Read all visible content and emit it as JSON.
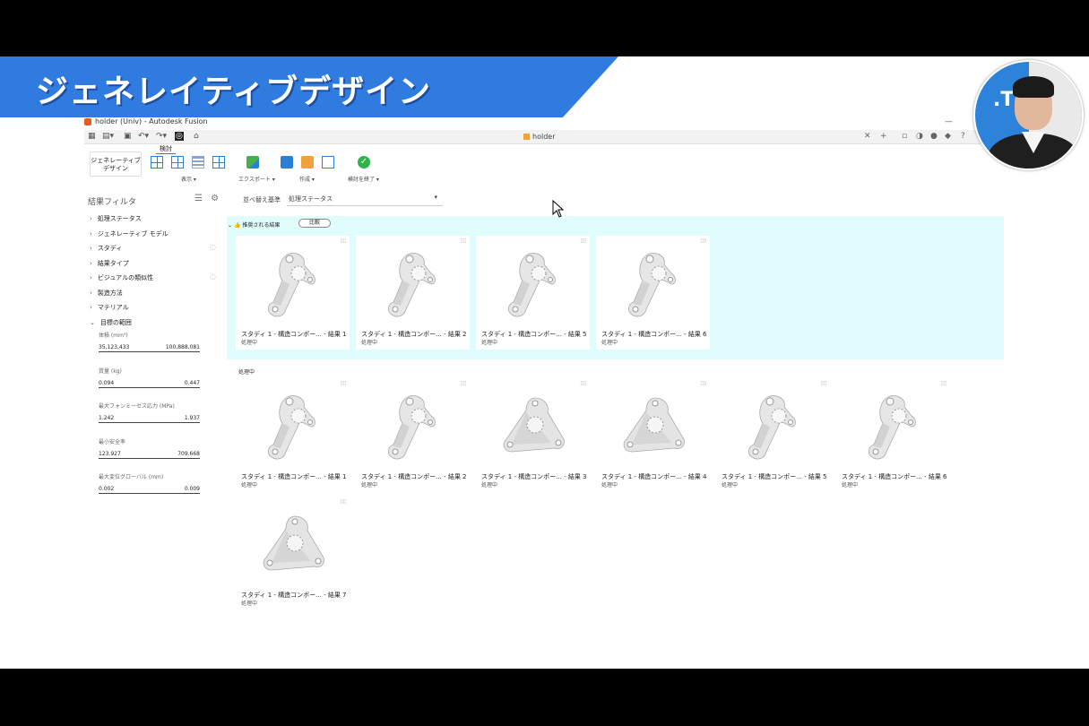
{
  "banner": {
    "title": "ジェネレイティブデザイン"
  },
  "window": {
    "title": "holder (Univ) - Autodesk Fusion",
    "doc_tab": "holder"
  },
  "ribbon": {
    "workspace": [
      "ジェネレーティブ",
      "デザイン"
    ],
    "tab": "検討",
    "groups": {
      "view": "表示 ▾",
      "export": "エクスポート ▾",
      "create": "作成 ▾",
      "finish": "検討を終了 ▾"
    }
  },
  "sidebar": {
    "title": "結果フィルタ",
    "items": [
      "処理ステータス",
      "ジェネレーティブ モデル",
      "スタディ",
      "結果タイプ",
      "ビジュアルの類似性",
      "製造方法",
      "マテリアル",
      "目標の範囲"
    ],
    "ranges": [
      {
        "label": "体積 (mm³)",
        "min": "35,123,433",
        "max": "100,888,081"
      },
      {
        "label": "質量 (kg)",
        "min": "0.094",
        "max": "0.447"
      },
      {
        "label": "最大フォンミーゼス応力 (MPa)",
        "min": "1.242",
        "max": "1.937"
      },
      {
        "label": "最小安全率",
        "min": "123.927",
        "max": "709.668"
      },
      {
        "label": "最大変位グローバル (mm)",
        "min": "0.002",
        "max": "0.009"
      }
    ]
  },
  "main": {
    "sort_label": "並べ替え基準",
    "sort_value": "処理ステータス",
    "recommended": {
      "header": "推奨される結果",
      "compare": "比較",
      "cards": [
        {
          "name": "スタディ 1 - 構造コンポー... - 結果 1",
          "status": "処理中",
          "shape": "arm"
        },
        {
          "name": "スタディ 1 - 構造コンポー... - 結果 2",
          "status": "処理中",
          "shape": "arm"
        },
        {
          "name": "スタディ 1 - 構造コンポー...  - 結果 5",
          "status": "処理中",
          "shape": "arm"
        },
        {
          "name": "スタディ 1 - 構造コンポー...  - 結果 6",
          "status": "処理中",
          "shape": "arm"
        }
      ]
    },
    "processing": {
      "header": "処理中",
      "cards": [
        {
          "name": "スタディ 1 - 構造コンポー... - 結果 1",
          "status": "処理中",
          "shape": "arm"
        },
        {
          "name": "スタディ 1 - 構造コンポー... - 結果 2",
          "status": "処理中",
          "shape": "arm"
        },
        {
          "name": "スタディ 1 - 構造コンポー... - 結果 3",
          "status": "処理中",
          "shape": "tri"
        },
        {
          "name": "スタディ 1 - 構造コンポー... - 結果 4",
          "status": "処理中",
          "shape": "tri"
        },
        {
          "name": "スタディ 1 - 構造コンポー...  - 結果 5",
          "status": "処理中",
          "shape": "arm"
        },
        {
          "name": "スタディ 1 - 構造コンポー...  - 結果 6",
          "status": "処理中",
          "shape": "arm"
        },
        {
          "name": "スタディ 1 - 構造コンポー... - 結果 7",
          "status": "処理中",
          "shape": "tri"
        }
      ]
    }
  },
  "webcam": {
    "logo": ".T"
  },
  "colors": {
    "banner": "#2f7be0",
    "recommended_bg": "#e0fcfc"
  }
}
